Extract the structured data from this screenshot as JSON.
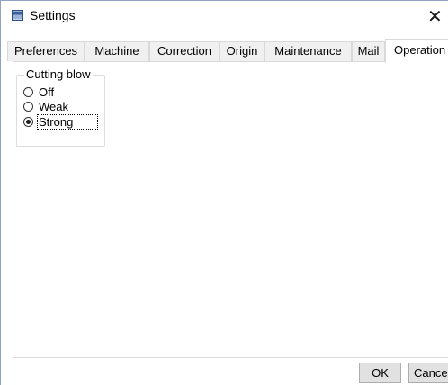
{
  "window": {
    "title": "Settings",
    "icon": "settings-app-icon",
    "close_glyph": "✕"
  },
  "tabs": [
    {
      "label": "Preferences",
      "selected": false
    },
    {
      "label": "Machine",
      "selected": false
    },
    {
      "label": "Correction",
      "selected": false
    },
    {
      "label": "Origin",
      "selected": false
    },
    {
      "label": "Maintenance",
      "selected": false
    },
    {
      "label": "Mail",
      "selected": false
    },
    {
      "label": "Operation",
      "selected": true
    }
  ],
  "cutting_blow": {
    "legend": "Cutting blow",
    "options": [
      {
        "label": "Off",
        "checked": false
      },
      {
        "label": "Weak",
        "checked": false
      },
      {
        "label": "Strong",
        "checked": true
      }
    ]
  },
  "buttons": {
    "ok_label": "OK",
    "cancel_label": "Cancel"
  },
  "colors": {
    "tab_background": "#f0f0f0",
    "button_background": "#e1e1e1",
    "border": "#d9d9d9"
  }
}
